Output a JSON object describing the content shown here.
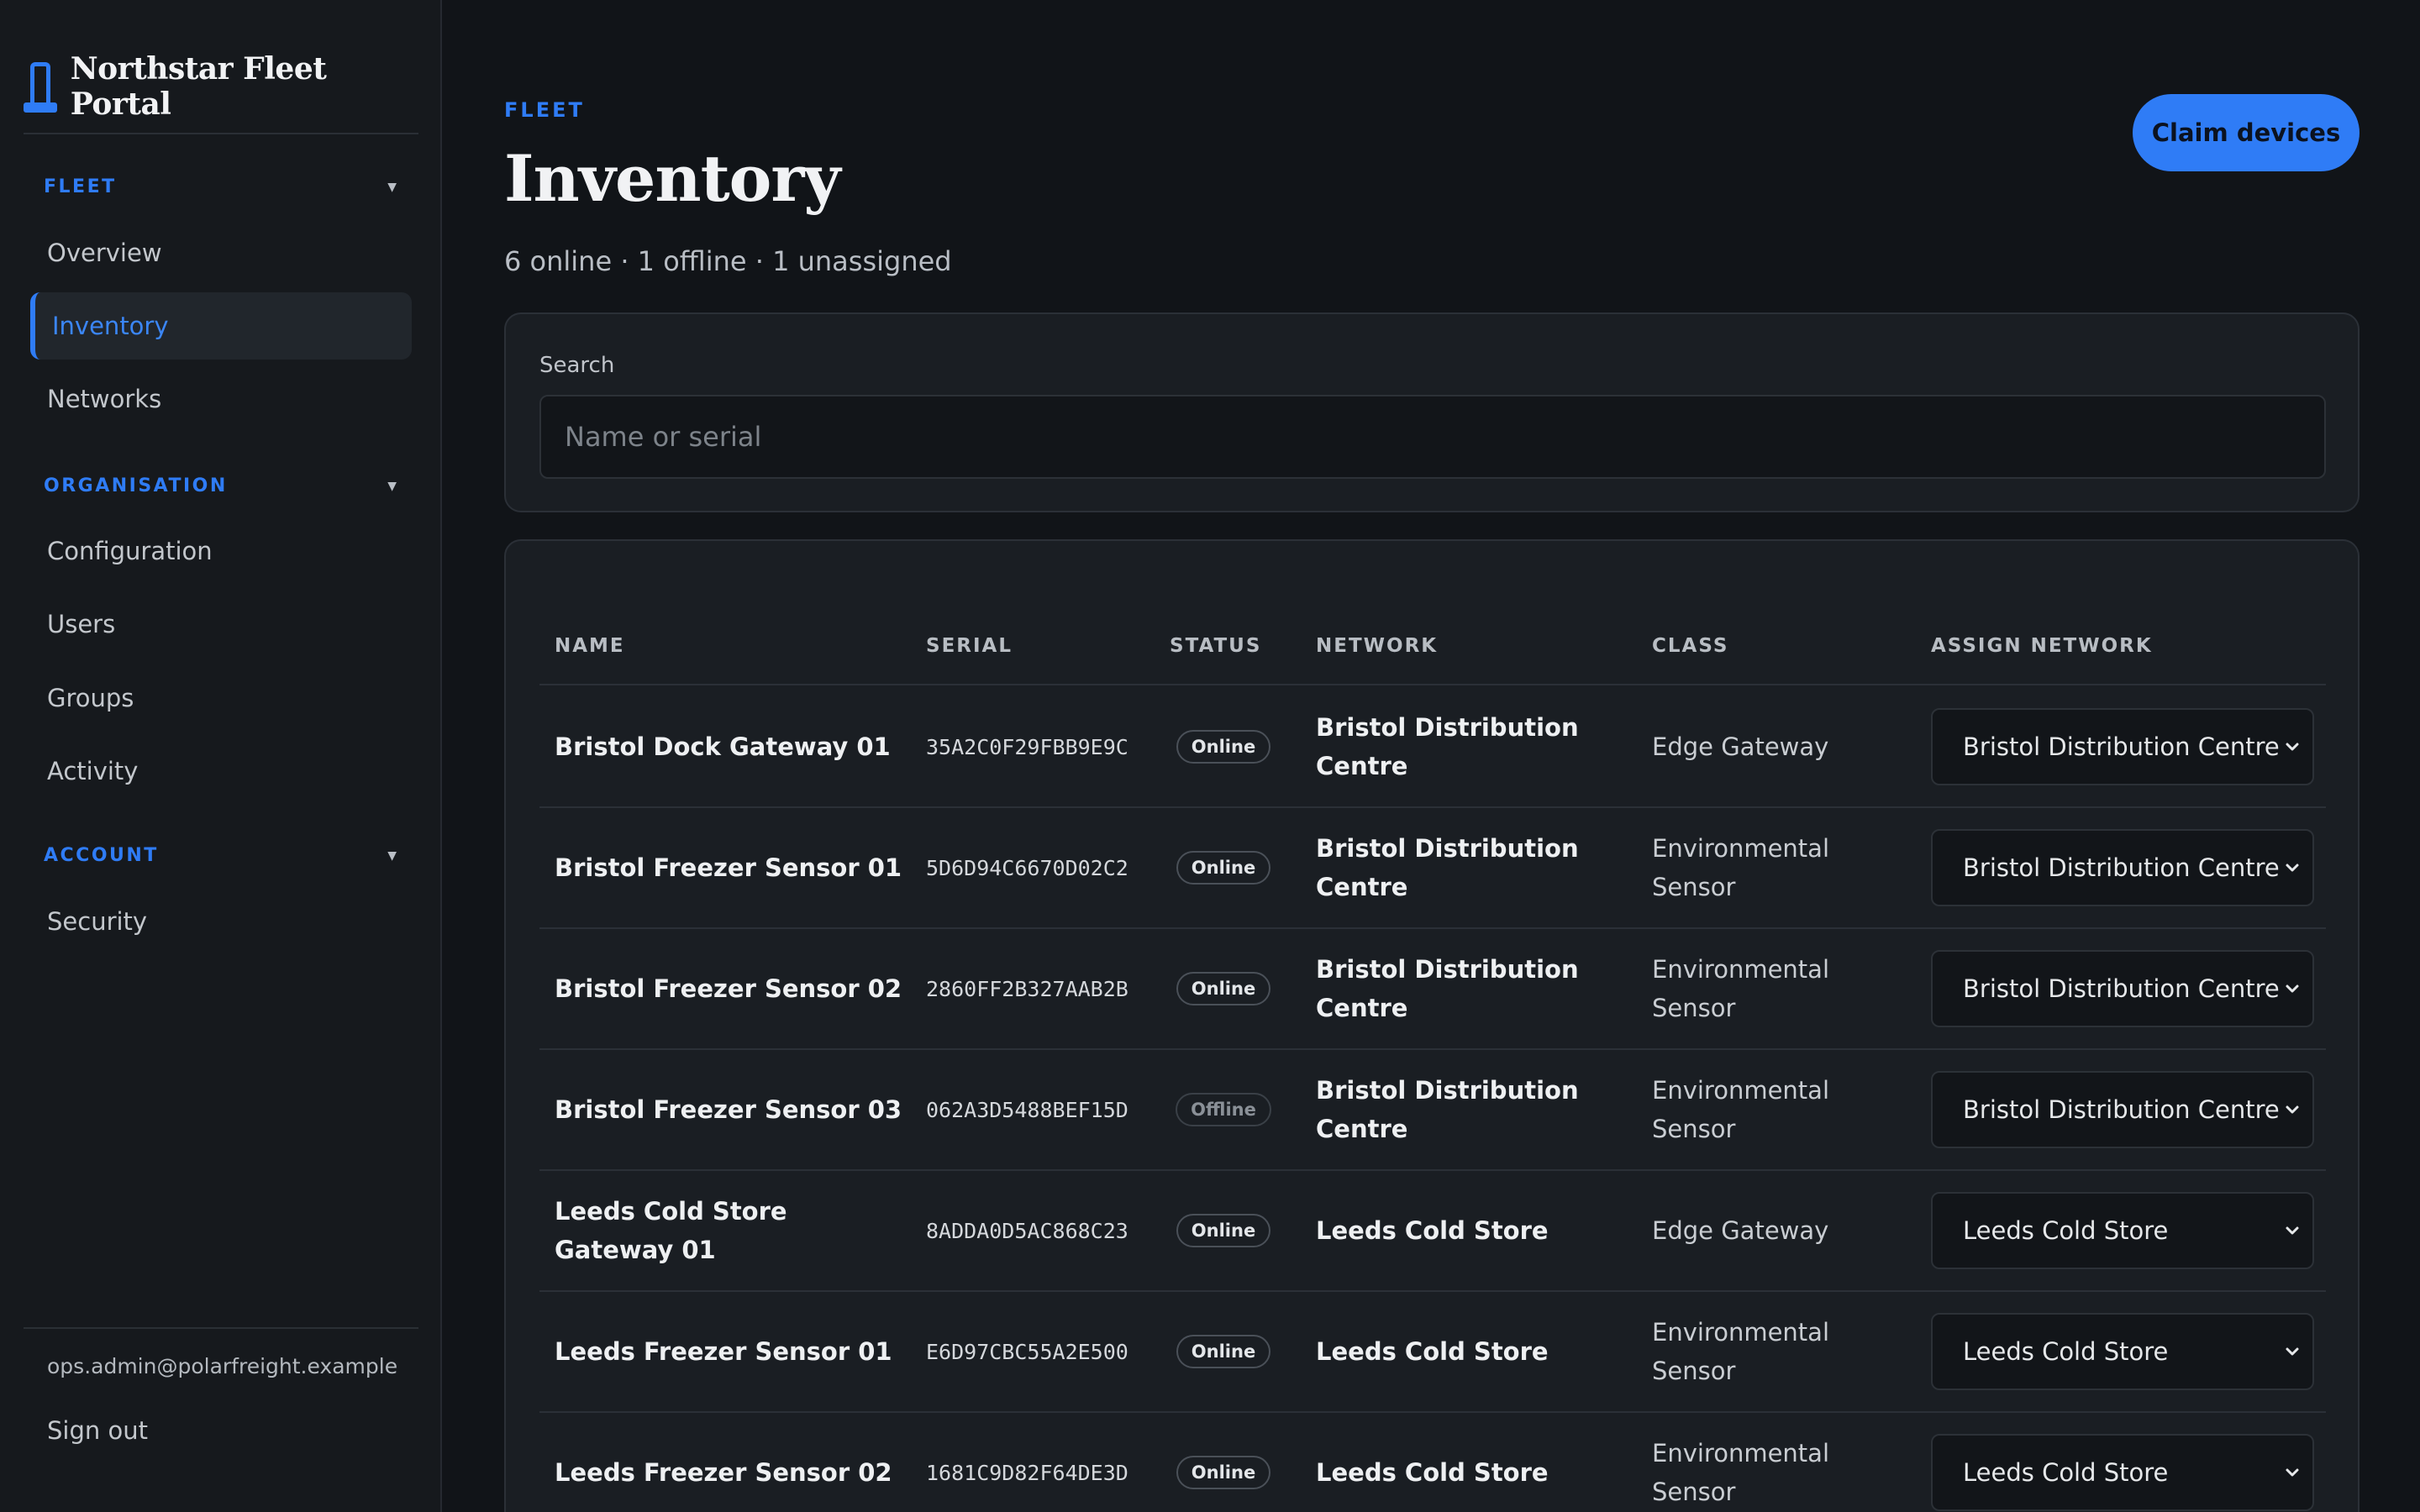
{
  "app": {
    "title": "Northstar Fleet Portal"
  },
  "sidebar": {
    "sections": [
      {
        "label": "FLEET",
        "items": [
          "Overview",
          "Inventory",
          "Networks"
        ]
      },
      {
        "label": "ORGANISATION",
        "items": [
          "Configuration",
          "Users",
          "Groups",
          "Activity"
        ]
      },
      {
        "label": "ACCOUNT",
        "items": [
          "Security"
        ]
      }
    ],
    "active_item": "Inventory",
    "user_email": "ops.admin@polarfreight.example",
    "sign_out": "Sign out"
  },
  "header": {
    "eyebrow": "FLEET",
    "title": "Inventory",
    "summary": "6 online · 1 offline · 1 unassigned",
    "claim_button": "Claim devices"
  },
  "search": {
    "label": "Search",
    "placeholder": "Name or serial",
    "value": ""
  },
  "table": {
    "columns": [
      "NAME",
      "SERIAL",
      "STATUS",
      "NETWORK",
      "CLASS",
      "ASSIGN NETWORK"
    ],
    "rows": [
      {
        "name": "Bristol Dock Gateway 01",
        "serial": "35A2C0F29FBB9E9C",
        "status": "Online",
        "network": "Bristol Distribution Centre",
        "class": "Edge Gateway",
        "assign": "Bristol Distribution Centre"
      },
      {
        "name": "Bristol Freezer Sensor 01",
        "serial": "5D6D94C6670D02C2",
        "status": "Online",
        "network": "Bristol Distribution Centre",
        "class": "Environmental Sensor",
        "assign": "Bristol Distribution Centre"
      },
      {
        "name": "Bristol Freezer Sensor 02",
        "serial": "2860FF2B327AAB2B",
        "status": "Online",
        "network": "Bristol Distribution Centre",
        "class": "Environmental Sensor",
        "assign": "Bristol Distribution Centre"
      },
      {
        "name": "Bristol Freezer Sensor 03",
        "serial": "062A3D5488BEF15D",
        "status": "Offline",
        "network": "Bristol Distribution Centre",
        "class": "Environmental Sensor",
        "assign": "Bristol Distribution Centre"
      },
      {
        "name": "Leeds Cold Store Gateway 01",
        "serial": "8ADDA0D5AC868C23",
        "status": "Online",
        "network": "Leeds Cold Store",
        "class": "Edge Gateway",
        "assign": "Leeds Cold Store"
      },
      {
        "name": "Leeds Freezer Sensor 01",
        "serial": "E6D97CBC55A2E500",
        "status": "Online",
        "network": "Leeds Cold Store",
        "class": "Environmental Sensor",
        "assign": "Leeds Cold Store"
      },
      {
        "name": "Leeds Freezer Sensor 02",
        "serial": "1681C9D82F64DE3D",
        "status": "Online",
        "network": "Leeds Cold Store",
        "class": "Environmental Sensor",
        "assign": "Leeds Cold Store"
      }
    ]
  },
  "colors": {
    "accent": "#2f7cf6",
    "background": "#111418",
    "card": "#1a1e23"
  }
}
